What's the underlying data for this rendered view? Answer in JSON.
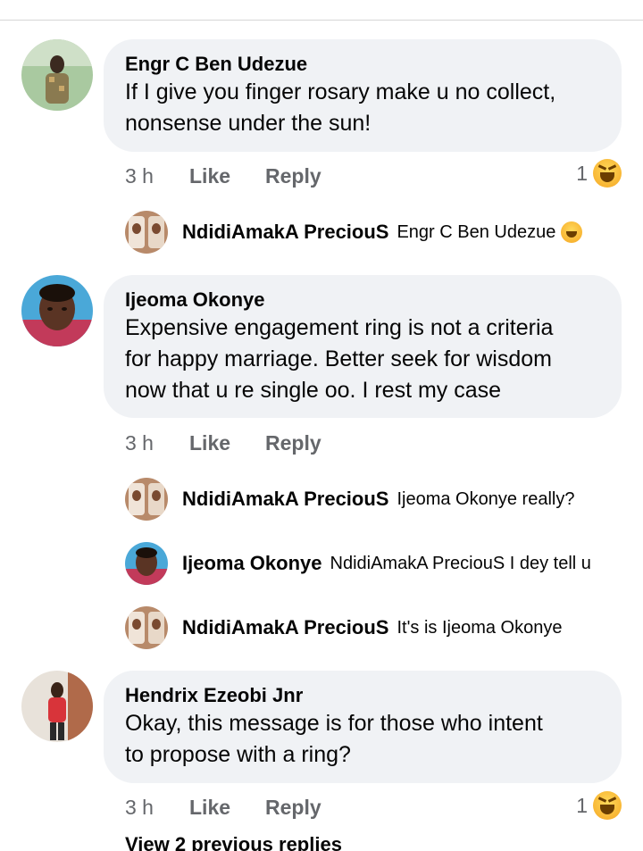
{
  "comments": [
    {
      "author": "Engr C Ben Udezue",
      "lines": [
        "If I give you finger rosary make u no collect,",
        "nonsense under the sun!"
      ],
      "time": "3 h",
      "like": "Like",
      "reply": "Reply",
      "reaction_count": "1",
      "reaction_icon": "haha-emoji-icon",
      "replies": [
        {
          "author": "NdidiAmakA PreciouS",
          "text": "Engr C Ben Udezue",
          "emoji": "laughing-emoji-icon"
        }
      ]
    },
    {
      "author": "Ijeoma Okonye",
      "lines": [
        "Expensive engagement ring is not a criteria",
        "for happy marriage. Better seek for wisdom",
        "now that u re single oo.  I rest my case"
      ],
      "time": "3 h",
      "like": "Like",
      "reply": "Reply",
      "replies": [
        {
          "author": "NdidiAmakA PreciouS",
          "text": "Ijeoma Okonye really?"
        },
        {
          "author": "Ijeoma Okonye",
          "text": "NdidiAmakA PreciouS I dey tell u"
        },
        {
          "author": "NdidiAmakA PreciouS",
          "text": "It's is Ijeoma Okonye"
        }
      ]
    },
    {
      "author": "Hendrix Ezeobi Jnr",
      "lines": [
        "Okay, this message is for those who intent",
        "to propose with a ring?"
      ],
      "time": "3 h",
      "like": "Like",
      "reply": "Reply",
      "reaction_count": "1",
      "reaction_icon": "haha-emoji-icon"
    }
  ],
  "view_previous": "View 2 previous replies",
  "colors": {
    "bubble": "#f0f2f5",
    "secondary_text": "#65676b",
    "primary_text": "#050505"
  }
}
